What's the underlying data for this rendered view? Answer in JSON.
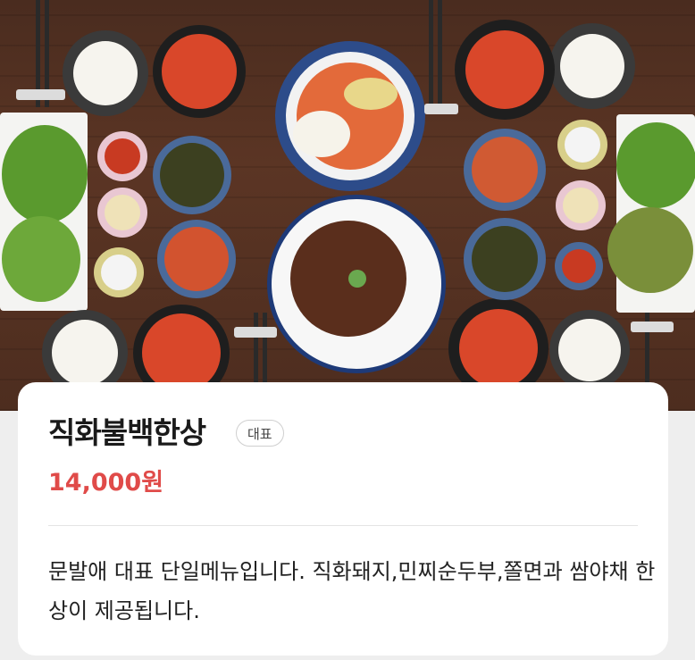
{
  "menu": {
    "image_alt": "직화불백한상",
    "title": "직화불백한상",
    "badge": "대표",
    "price": "14,000원",
    "description": "문발애 대표 단일메뉴입니다. 직화돼지,민찌순두부,쫄면과 쌈야채 한상이 제공됩니다."
  },
  "colors": {
    "price": "#e04b49",
    "wood": "#5b3524",
    "card": "#ffffff"
  }
}
